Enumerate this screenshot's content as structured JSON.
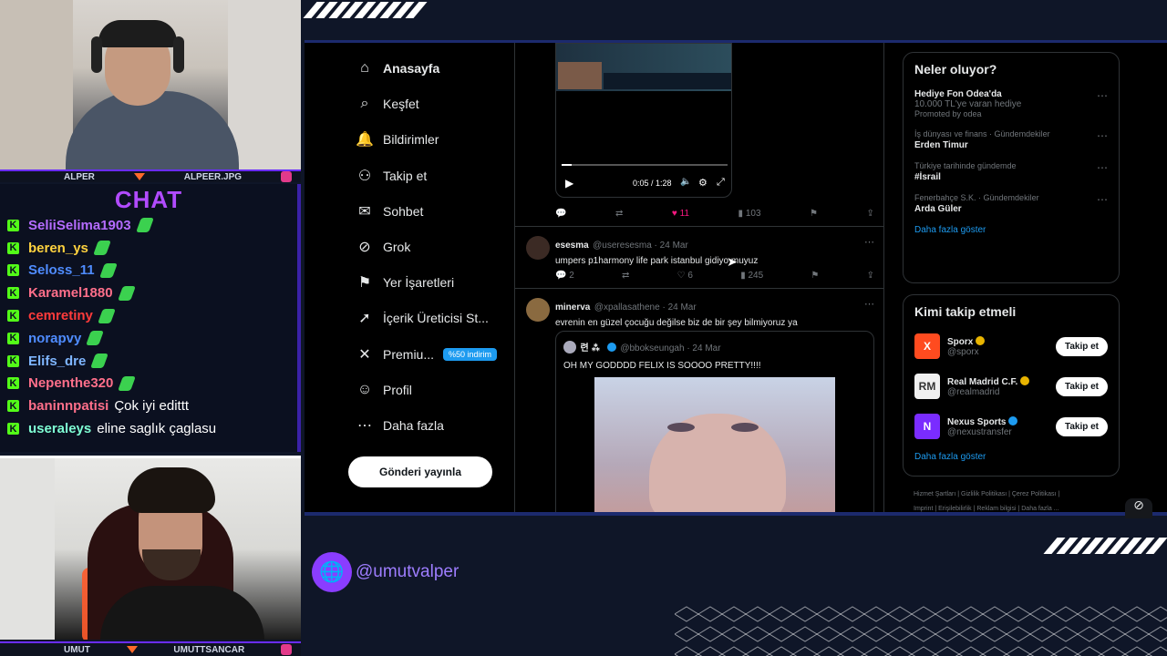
{
  "top_cam": {
    "left_label": "ALPER",
    "right_label": "ALPEER.JPG"
  },
  "bottom_cam": {
    "left_label": "UMUT",
    "right_label": "UMUTTSANCAR"
  },
  "chat": {
    "title": "CHAT",
    "messages": [
      {
        "user": "SeliiSelima1903",
        "color": "#b56cff",
        "text": "",
        "emote": true
      },
      {
        "user": "beren_ys",
        "color": "#ffd23f",
        "text": "",
        "emote": true
      },
      {
        "user": "Seloss_11",
        "color": "#4f8cff",
        "text": "",
        "emote": true
      },
      {
        "user": "Karamel1880",
        "color": "#ff6f8a",
        "text": "",
        "emote": true
      },
      {
        "user": "cemretiny",
        "color": "#ff3b3b",
        "text": "",
        "emote": true
      },
      {
        "user": "norapvy",
        "color": "#4f8cff",
        "text": "",
        "emote": true
      },
      {
        "user": "Elifs_dre",
        "color": "#7fb6ff",
        "text": "",
        "emote": true
      },
      {
        "user": "Nepenthe320",
        "color": "#ff6f8a",
        "text": "",
        "emote": true
      },
      {
        "user": "baninnpatisi",
        "color": "#ff6f8a",
        "text": "Çok iyi edittt",
        "emote": false
      },
      {
        "user": "useraleys",
        "color": "#7fffd4",
        "text": "eline saglık çaglasu",
        "emote": false
      }
    ]
  },
  "x_nav": {
    "items": [
      {
        "label": "Anasayfa",
        "icon": "home-icon",
        "glyph": "⌂",
        "bold": true
      },
      {
        "label": "Keşfet",
        "icon": "search-icon",
        "glyph": "⌕"
      },
      {
        "label": "Bildirimler",
        "icon": "bell-icon",
        "glyph": "🔔"
      },
      {
        "label": "Takip et",
        "icon": "add-user-icon",
        "glyph": "⚇"
      },
      {
        "label": "Sohbet",
        "icon": "mail-icon",
        "glyph": "✉"
      },
      {
        "label": "Grok",
        "icon": "grok-icon",
        "glyph": "⊘"
      },
      {
        "label": "Yer İşaretleri",
        "icon": "bookmark-icon",
        "glyph": "⚑"
      },
      {
        "label": "İçerik Üreticisi St...",
        "icon": "rocket-icon",
        "glyph": "➚"
      },
      {
        "label": "Premiu...",
        "icon": "x-logo-icon",
        "glyph": "✕",
        "badge": "%50 indirim"
      },
      {
        "label": "Profil",
        "icon": "profile-icon",
        "glyph": "☺"
      },
      {
        "label": "Daha fazla",
        "icon": "more-icon",
        "glyph": "⋯"
      }
    ],
    "post_button": "Gönderi yayınla"
  },
  "video": {
    "time": "0:05 / 1:28",
    "progress": 0.06
  },
  "tweet1_actions": {
    "likes": "11",
    "views": "103"
  },
  "tweet2": {
    "name": "esesma",
    "handle": "@useresesma · 24 Mar",
    "text": "umpers p1harmony life park istanbul gidiyo muyuz",
    "replies": "2",
    "likes": "6",
    "views": "245"
  },
  "tweet3": {
    "name": "minerva",
    "handle": "@xpallasathene · 24 Mar",
    "text": "evrenin en güzel çocuğu değilse biz de bir şey bilmiyoruz ya",
    "quote_name": "련 ⁂",
    "quote_handle": "@bbokseungah · 24 Mar",
    "quote_text": "OH MY GODDDD FELIX IS SOOOO PRETTY!!!!"
  },
  "trends": {
    "title": "Neler oluyor?",
    "items": [
      {
        "cat": "",
        "name": "Hediye Fon Odea'da",
        "sub": "10.000 TL'ye varan hediye",
        "promo": "Promoted by odea"
      },
      {
        "cat": "İş dünyası ve finans · Gündemdekiler",
        "name": "Erden Timur",
        "sub": "",
        "promo": ""
      },
      {
        "cat": "Türkiye tarihinde gündemde",
        "name": "#İsrail",
        "sub": "",
        "promo": ""
      },
      {
        "cat": "Fenerbahçe S.K. · Gündemdekiler",
        "name": "Arda Güler",
        "sub": "",
        "promo": ""
      }
    ],
    "more": "Daha fazla göster"
  },
  "who_to_follow": {
    "title": "Kimi takip etmeli",
    "items": [
      {
        "name": "Sporx",
        "handle": "@sporx",
        "color": "#ff4b1f",
        "letter": "X",
        "badge": "#e8b400"
      },
      {
        "name": "Real Madrid C.F.",
        "handle": "@realmadrid",
        "color": "#f0f0f0",
        "letter": "RM",
        "badge": "#e8b400"
      },
      {
        "name": "Nexus Sports",
        "handle": "@nexustransfer",
        "color": "#7a2cff",
        "letter": "N",
        "badge": "#1d9bf0"
      }
    ],
    "follow_label": "Takip et",
    "more": "Daha fazla göster"
  },
  "footer": {
    "line1": "Hizmet Şartları  |  Gizlilik Politikası  |  Çerez Politikası  |",
    "line2": "Imprint  |  Erişilebilirlik  |  Reklam bilgisi  |  Daha fazla ..."
  },
  "streamer_handle": "@umutvalper"
}
